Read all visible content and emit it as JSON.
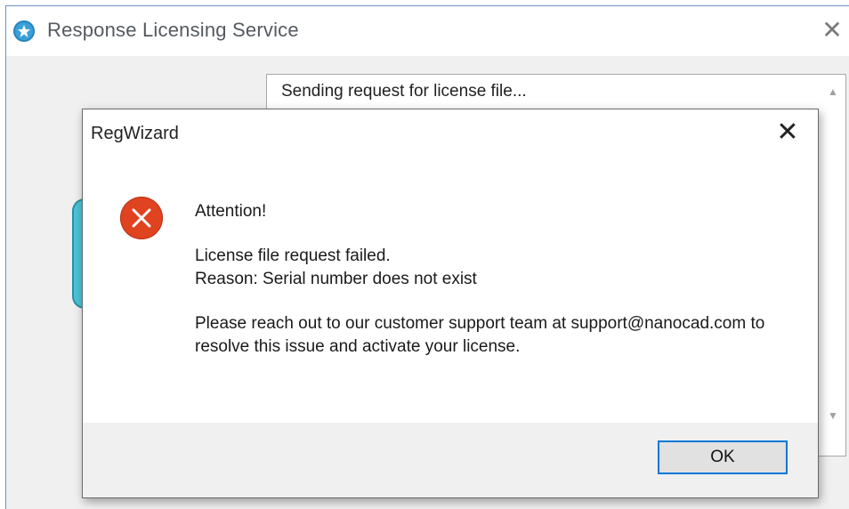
{
  "parent_window": {
    "title": "Response Licensing Service",
    "close_glyph": "✕",
    "log_text": "Sending request for license file..."
  },
  "dialog": {
    "title": "RegWizard",
    "close_glyph": "✕",
    "icon": "error-icon",
    "message": {
      "heading": "Attention!",
      "failed": "License file request failed.",
      "reason": "Reason: Serial number does not exist",
      "support": "Please reach out to our customer support team at support@nanocad.com to resolve this issue and activate your license."
    },
    "ok_label": "OK"
  },
  "colors": {
    "accent": "#0078d7",
    "error": "#e0431f",
    "app_icon": "#3aa0d8"
  }
}
